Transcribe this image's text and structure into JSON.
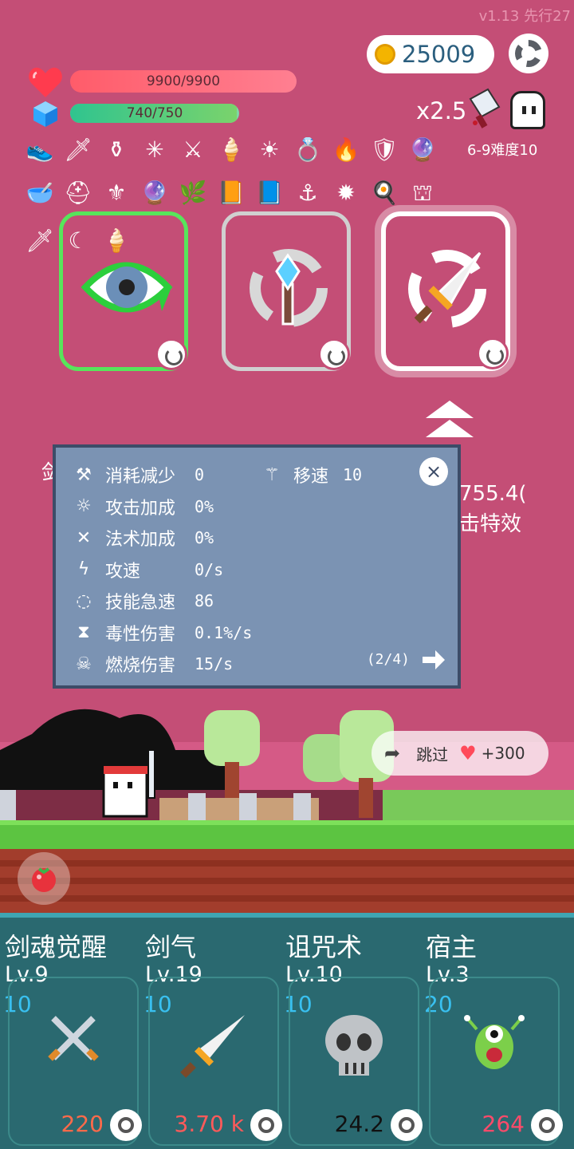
{
  "version": "v1.13 先行27",
  "coins": "25009",
  "hp": {
    "text": "9900/9900",
    "fraction": 1.0
  },
  "mp": {
    "text": "740/750",
    "fraction": 0.987
  },
  "multiplier": "x2.5",
  "difficulty": "6-9难度10",
  "items_row1": [
    "shoe-icon",
    "dagger-icon",
    "cauldron-icon",
    "mace-icon",
    "sword-icon",
    "ice-cream-icon",
    "sun-orb-icon",
    "ring-icon",
    "flame-icon",
    "shield-icon",
    "crystal-ball-icon"
  ],
  "items_row2": [
    "mortar-icon",
    "helmet-icon",
    "viking-helmet-icon",
    "purple-orb-icon",
    "plant-icon",
    "book-icon",
    "spellbook-icon",
    "hook-icon",
    "spiked-ball-icon",
    "egg-icon",
    "tombstone-icon"
  ],
  "items_row3": [
    "short-sword-icon",
    "sickle-icon",
    "ice-cream-icon"
  ],
  "panel": {
    "stats": [
      {
        "icon": "axe-icon",
        "label": "消耗减少",
        "value": "0"
      },
      {
        "icon": "sun-icon",
        "label": "攻击加成",
        "value": "0%"
      },
      {
        "icon": "sparkle-icon",
        "label": "法术加成",
        "value": "0%"
      },
      {
        "icon": "lightning-icon",
        "label": "攻速",
        "value": "0/s"
      },
      {
        "icon": "cooldown-icon",
        "label": "技能急速",
        "value": "86"
      },
      {
        "icon": "hourglass-icon",
        "label": "毒性伤害",
        "value": "0.1%/s"
      },
      {
        "icon": "skull-icon",
        "label": "燃烧伤害",
        "value": "15/s"
      }
    ],
    "speed": {
      "icon": "wand-icon",
      "label": "移速",
      "value": "10"
    },
    "page": "(2/4)",
    "close": "×"
  },
  "behind": {
    "left": "剑",
    "num": "755.4(",
    "effect": "击特效"
  },
  "skip": {
    "label": "跳过",
    "reward": "+300"
  },
  "bottom": [
    {
      "name": "剑魂觉醒",
      "level": "Lv.9",
      "cost": "10",
      "value": "220",
      "color": "#ff6a4a",
      "icon": "crossed-swords-icon"
    },
    {
      "name": "剑气",
      "level": "Lv.19",
      "cost": "10",
      "value": "3.70 k",
      "color": "#ff5a5a",
      "icon": "sword-icon"
    },
    {
      "name": "诅咒术",
      "level": "Lv.10",
      "cost": "10",
      "value": "24.2",
      "color": "#111111",
      "icon": "skull-icon"
    },
    {
      "name": "宿主",
      "level": "Lv.3",
      "cost": "20",
      "value": "264",
      "color": "#ff4a6a",
      "icon": "alien-icon"
    }
  ]
}
